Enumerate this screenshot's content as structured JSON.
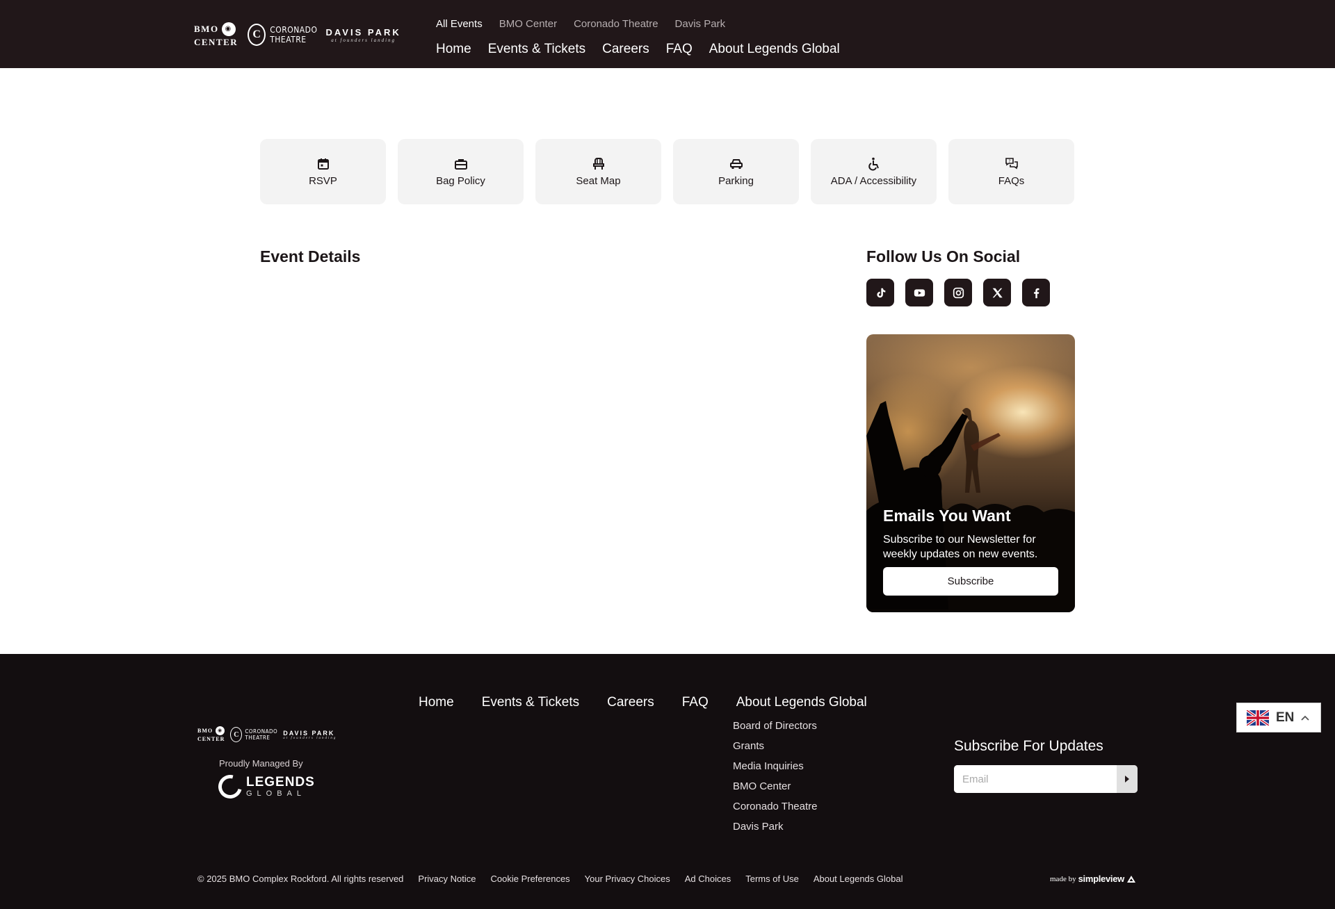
{
  "header": {
    "logos": {
      "bmo_line1": "BMO",
      "bmo_line2": "CENTER",
      "coronado_line1": "CORONADO",
      "coronado_line2": "THEATRE",
      "davis_line1": "DAVIS PARK",
      "davis_line2": "at founders landing"
    },
    "subnav": [
      "All Events",
      "BMO Center",
      "Coronado Theatre",
      "Davis Park"
    ],
    "mainnav": [
      "Home",
      "Events & Tickets",
      "Careers",
      "FAQ",
      "About Legends Global"
    ]
  },
  "quick_links": [
    {
      "label": "RSVP",
      "icon": "calendar-icon"
    },
    {
      "label": "Bag Policy",
      "icon": "briefcase-icon"
    },
    {
      "label": "Seat Map",
      "icon": "chair-icon"
    },
    {
      "label": "Parking",
      "icon": "car-icon"
    },
    {
      "label": "ADA / Accessibility",
      "icon": "wheelchair-icon"
    },
    {
      "label": "FAQs",
      "icon": "chat-question-icon"
    }
  ],
  "main": {
    "event_details_title": "Event Details",
    "social_title": "Follow Us On Social",
    "social": [
      "tiktok-icon",
      "youtube-icon",
      "instagram-icon",
      "x-icon",
      "facebook-icon"
    ],
    "promo": {
      "title": "Emails You Want",
      "text": "Subscribe to our Newsletter for weekly updates on new events.",
      "button": "Subscribe"
    }
  },
  "footer": {
    "managed_by": "Proudly Managed By",
    "legends_line1": "LEGENDS",
    "legends_line2": "GLOBAL",
    "nav": [
      "Home",
      "Events & Tickets",
      "Careers",
      "FAQ",
      "About Legends Global"
    ],
    "about_sub": [
      "Board of Directors",
      "Grants",
      "Media Inquiries",
      "BMO Center",
      "Coronado Theatre",
      "Davis Park"
    ],
    "subscribe_title": "Subscribe For Updates",
    "email_placeholder": "Email",
    "bottom_links": [
      "© 2025 BMO Complex Rockford. All rights reserved",
      "Privacy Notice",
      "Cookie Preferences",
      "Your Privacy Choices",
      "Ad Choices",
      "Terms of Use",
      "About Legends Global"
    ],
    "madeby_prefix": "made by",
    "madeby_brand": "simpleview"
  },
  "language": {
    "code": "EN"
  },
  "colors": {
    "header_bg": "#211719",
    "footer_bg": "#130e10",
    "card_bg": "#f3f3f3"
  }
}
